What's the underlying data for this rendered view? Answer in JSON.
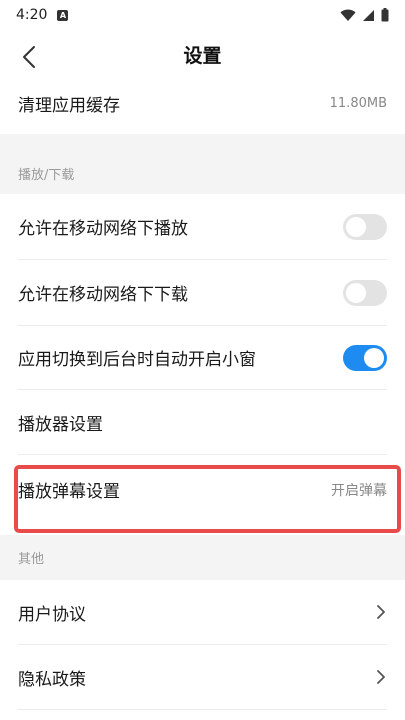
{
  "status_bar": {
    "time": "4:20",
    "app_badge": "A"
  },
  "header": {
    "title": "设置"
  },
  "rows": {
    "clear_cache": {
      "label": "清理应用缓存",
      "value": "11.80MB"
    },
    "section_playback": "播放/下载",
    "allow_mobile_play": {
      "label": "允许在移动网络下播放",
      "state": "off"
    },
    "allow_mobile_download": {
      "label": "允许在移动网络下下载",
      "state": "off"
    },
    "auto_mini_window": {
      "label": "应用切换到后台时自动开启小窗",
      "state": "on"
    },
    "player_settings": {
      "label": "播放器设置"
    },
    "danmaku_settings": {
      "label": "播放弹幕设置",
      "value": "开启弹幕"
    },
    "section_other": "其他",
    "user_agreement": {
      "label": "用户协议"
    },
    "privacy_policy": {
      "label": "隐私政策"
    }
  },
  "colors": {
    "accent": "#1e8bf0",
    "highlight": "#e94b4b",
    "section_bg": "#f4f4f5"
  }
}
